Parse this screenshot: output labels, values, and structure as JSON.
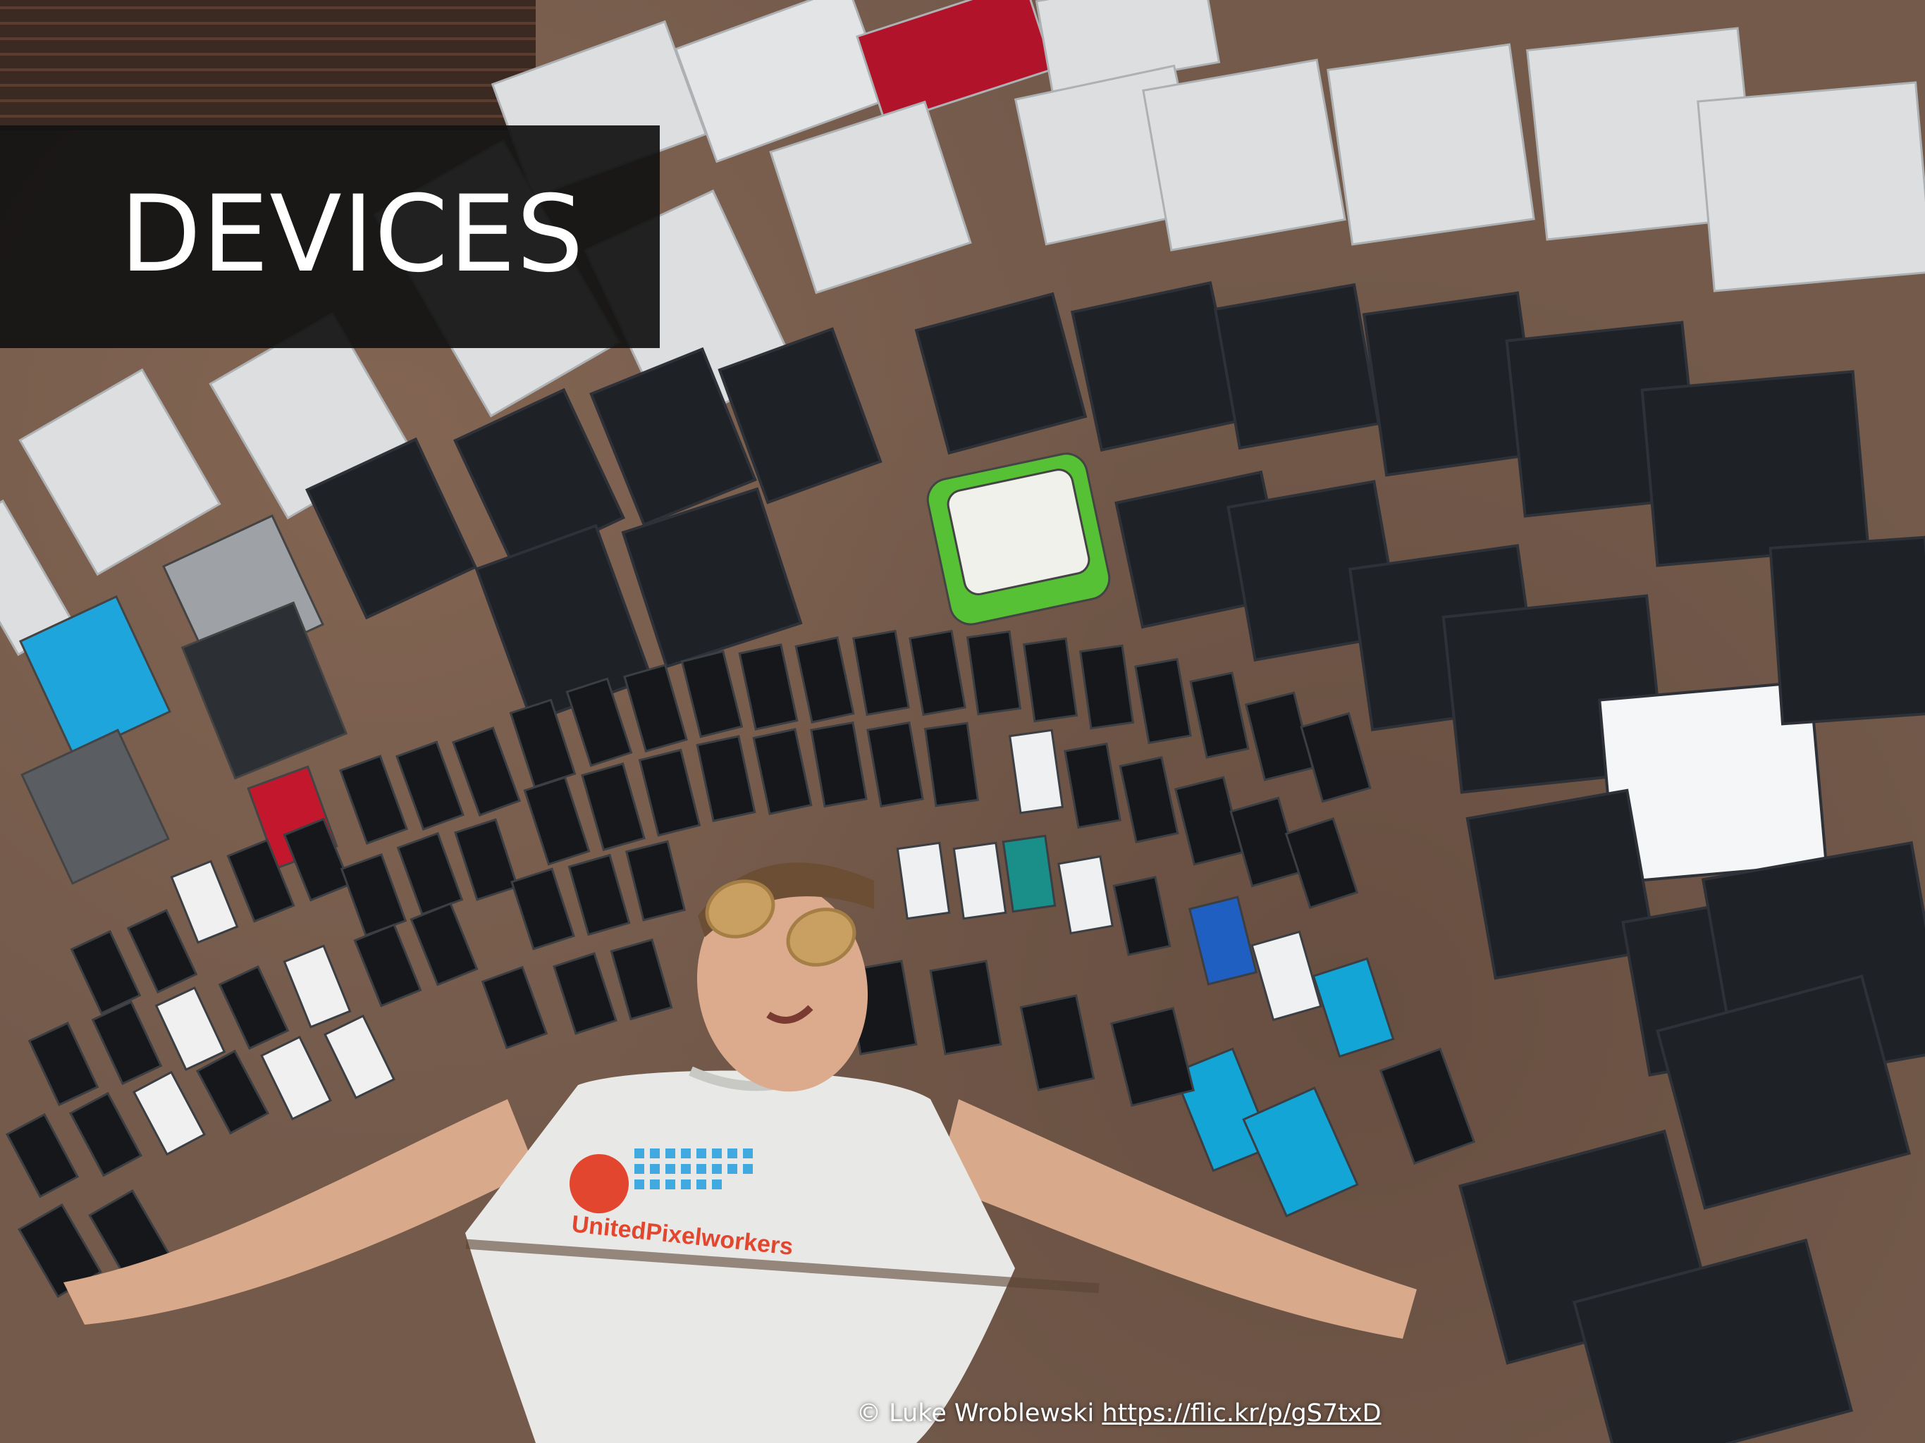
{
  "slide": {
    "title": "DEVICES",
    "credit": {
      "author": "© Luke Wroblewski",
      "url_text": "https://flic.kr/p/gS7txD"
    }
  },
  "photo": {
    "subject": "person lying on pavement surrounded by rows of devices",
    "shirt_text": "UnitedPixelworkers",
    "colors": {
      "pavement": "#735a4b",
      "laptop": "#dfe1e3",
      "screen": "#1c1f24",
      "red_accent": "#c3172d",
      "green_accent": "#56c135",
      "cyan_accent": "#1fa3d9"
    }
  }
}
